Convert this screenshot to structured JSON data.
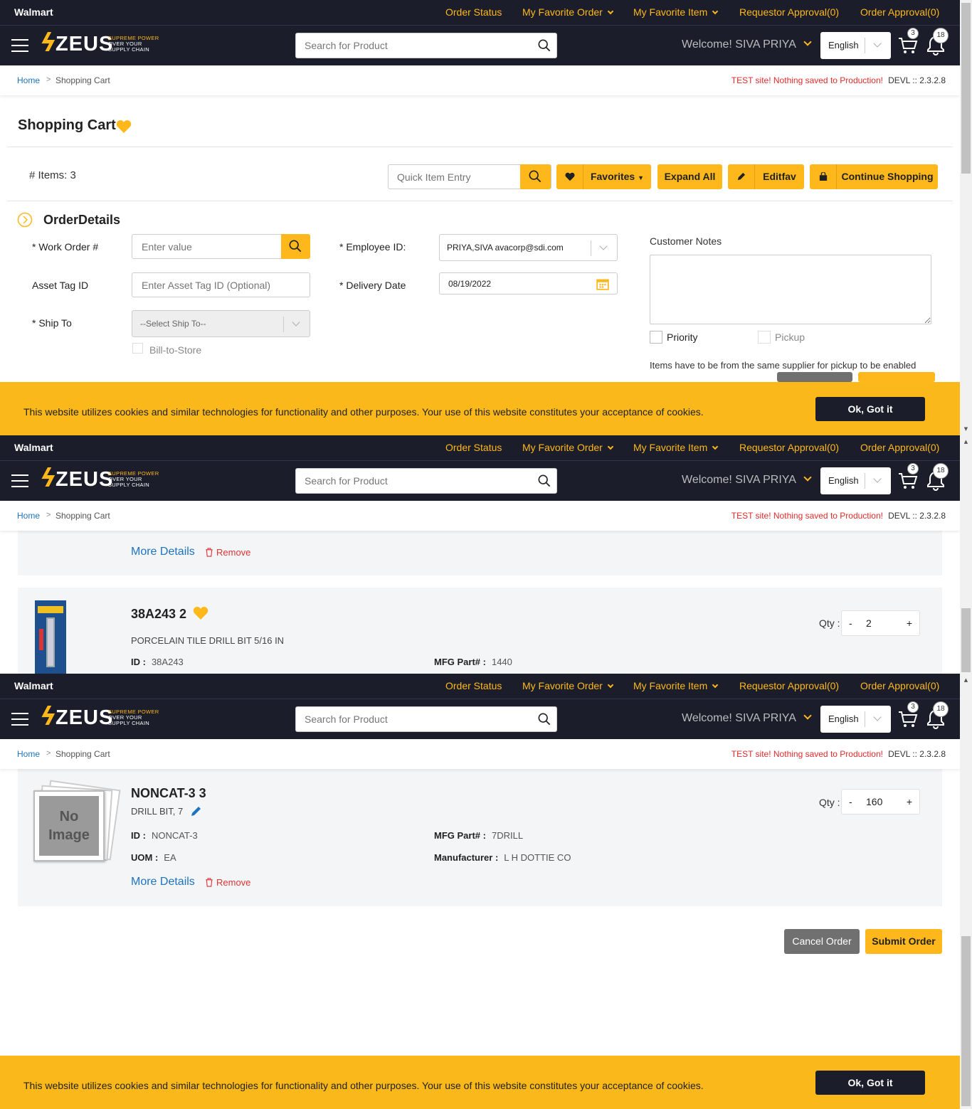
{
  "header": {
    "brand": "Walmart",
    "nav": {
      "order_status": "Order Status",
      "fav_order": "My Favorite Order",
      "fav_item": "My Favorite Item",
      "req_approval": "Requestor Approval(0)",
      "order_approval": "Order Approval(0)"
    },
    "logo": {
      "name": "ZEUS",
      "tag1": "SUPREME POWER",
      "tag2": "OVER YOUR",
      "tag3": "SUPPLY CHAIN"
    },
    "search_placeholder": "Search for Product",
    "welcome": "Welcome! SIVA PRIYA",
    "language": "English",
    "cart_count": "3",
    "notif_count": "18"
  },
  "breadcrumb": {
    "home": "Home",
    "sep": ">",
    "current": "Shopping Cart",
    "test_notice": "TEST site! Nothing saved to Production!",
    "version": "DEVL :: 2.3.2.8"
  },
  "cart": {
    "title": "Shopping Cart",
    "items_label": "# Items:",
    "items_count": "3",
    "quick_entry_placeholder": "Quick Item Entry",
    "favorites": "Favorites",
    "expand_all": "Expand All",
    "editfav": "Editfav",
    "continue": "Continue Shopping"
  },
  "order": {
    "title": "OrderDetails",
    "work_order_label": "* Work Order #",
    "work_order_placeholder": "Enter value",
    "asset_label": "Asset Tag ID",
    "asset_placeholder": "Enter Asset Tag ID (Optional)",
    "ship_to_label": "* Ship To",
    "ship_to_value": "--Select Ship To--",
    "bill_to_store": "Bill-to-Store",
    "employee_label": "* Employee ID:",
    "employee_value": "PRIYA,SIVA avacorp@sdi.com",
    "delivery_label": "* Delivery Date",
    "delivery_value": "08/19/2022",
    "notes_label": "Customer Notes",
    "priority": "Priority",
    "pickup": "Pickup",
    "pickup_note": "Items have to be from the same supplier for pickup to be enabled",
    "cancel": "Cancel Order",
    "submit": "Submit Order"
  },
  "cookie": {
    "text": "This website utilizes cookies and similar technologies for functionality and other purposes. Your use of this website constitutes your acceptance of cookies.",
    "ok": "Ok, Got it"
  },
  "items": [
    {
      "more": "More Details",
      "remove": "Remove"
    },
    {
      "name": "38A243 2",
      "desc": "PORCELAIN TILE DRILL BIT 5/16 IN",
      "id_label": "ID :",
      "id": "38A243",
      "mfg_label": "MFG Part# :",
      "mfg": "1440",
      "qty_label": "Qty :",
      "qty": "2",
      "minus": "-",
      "plus": "+"
    },
    {
      "name": "NONCAT-3 3",
      "desc": "DRILL BIT, 7",
      "id_label": "ID :",
      "id": "NONCAT-3",
      "uom_label": "UOM :",
      "uom": "EA",
      "mfg_label": "MFG Part# :",
      "mfg": "7DRILL",
      "manu_label": "Manufacturer :",
      "manu": "L H DOTTIE CO",
      "qty_label": "Qty :",
      "qty": "160",
      "minus": "-",
      "plus": "+",
      "more": "More Details",
      "remove": "Remove",
      "noimage1": "No",
      "noimage2": "Image"
    }
  ],
  "colors": {
    "accent": "#ffb81c",
    "dark": "#1b1d2a",
    "link": "#1e73be",
    "danger": "#e02a2a"
  }
}
